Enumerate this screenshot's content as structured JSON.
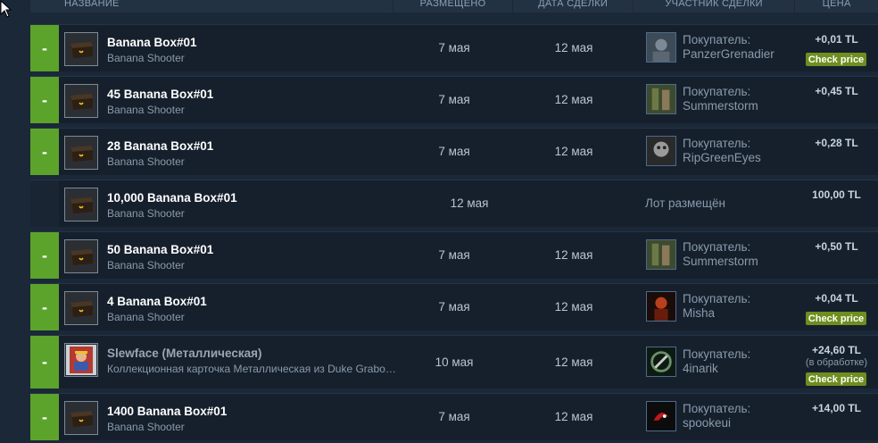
{
  "header": {
    "name": "Название",
    "listed": "Размещено",
    "deal": "Дата сделки",
    "party": "Участник сделки",
    "price": "Цена"
  },
  "check_price_label": "Check price",
  "rows": [
    {
      "bar": "-",
      "title": "Banana Box#01",
      "game": "Banana Shooter",
      "listed": "7 мая",
      "deal": "12 мая",
      "party_label": "Покупатель:",
      "party_name": "PanzerGrenadier",
      "price": "+0,01 TL",
      "check_price": true,
      "avatar": "avatar-gray"
    },
    {
      "bar": "-",
      "title": "45 Banana Box#01",
      "game": "Banana Shooter",
      "listed": "7 мая",
      "deal": "12 мая",
      "party_label": "Покупатель:",
      "party_name": "Summerstorm",
      "price": "+0,45 TL",
      "avatar": "avatar-forest"
    },
    {
      "bar": "-",
      "title": "28 Banana Box#01",
      "game": "Banana Shooter",
      "listed": "7 мая",
      "deal": "12 мая",
      "party_label": "Покупатель:",
      "party_name": "RipGreenEyes",
      "price": "+0,28 TL",
      "avatar": "avatar-bw"
    },
    {
      "bar": "",
      "title": "10,000 Banana Box#01",
      "game": "Banana Shooter",
      "listed": "12 мая",
      "deal": "",
      "status": "Лот размещён",
      "price": "100,00 TL",
      "avatar": ""
    },
    {
      "bar": "-",
      "title": "50 Banana Box#01",
      "game": "Banana Shooter",
      "listed": "7 мая",
      "deal": "12 мая",
      "party_label": "Покупатель:",
      "party_name": "Summerstorm",
      "price": "+0,50 TL",
      "avatar": "avatar-forest"
    },
    {
      "bar": "-",
      "title": "4 Banana Box#01",
      "game": "Banana Shooter",
      "listed": "7 мая",
      "deal": "12 мая",
      "party_label": "Покупатель:",
      "party_name": "Misha",
      "price": "+0,04 TL",
      "check_price": true,
      "avatar": "avatar-red"
    },
    {
      "bar": "-",
      "title": "Slewface (Металлическая)",
      "game": "Коллекционная карточка Металлическая из Duke Grabowski, Mighty Swashbuckler",
      "listed": "10 мая",
      "deal": "12 мая",
      "party_label": "Покупатель:",
      "party_name": "4inarik",
      "price": "+24,60 TL",
      "note": "(в обработке)",
      "check_price": true,
      "avatar": "avatar-ring",
      "metal": true
    },
    {
      "bar": "-",
      "title": "1400 Banana Box#01",
      "game": "Banana Shooter",
      "listed": "7 мая",
      "deal": "12 мая",
      "party_label": "Покупатель:",
      "party_name": "spookeui",
      "price": "+14,00 TL",
      "avatar": "avatar-dark-red"
    }
  ]
}
